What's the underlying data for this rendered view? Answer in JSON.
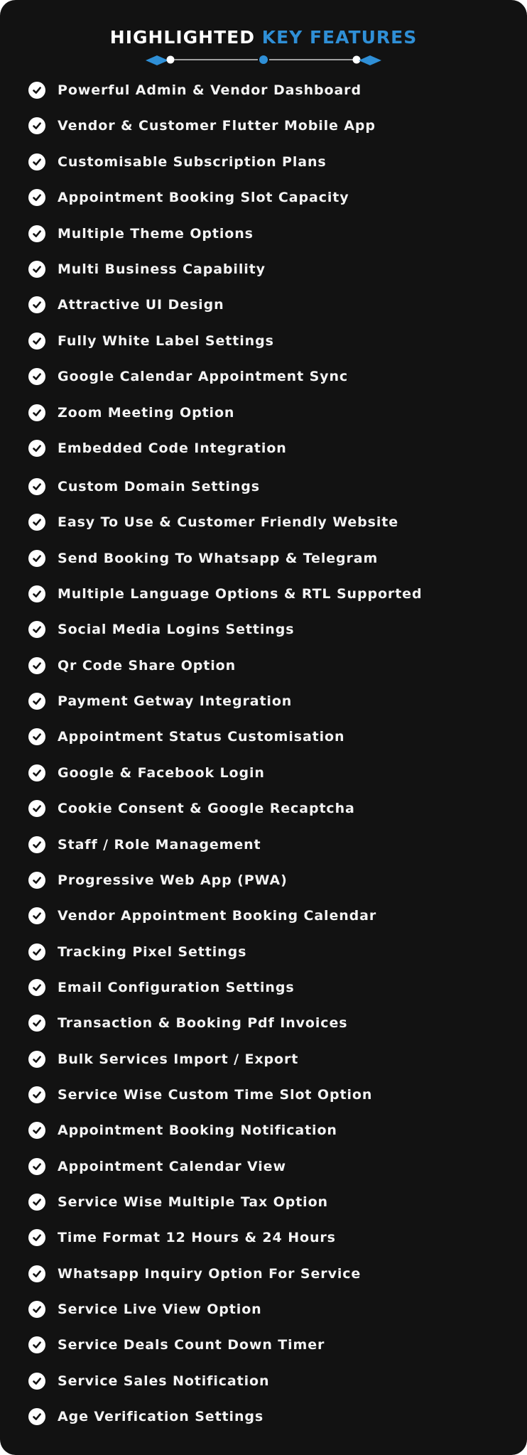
{
  "header": {
    "title_part1": "HIGHLIGHTED",
    "title_part2": "KEY FEATURES",
    "accent_color": "#2f8fd6"
  },
  "features": [
    "Powerful Admin & Vendor Dashboard",
    "Vendor & Customer Flutter Mobile App",
    "Customisable Subscription Plans",
    "Appointment Booking Slot Capacity",
    "Multiple Theme Options",
    "Multi Business Capability",
    "Attractive UI Design",
    "Fully White Label Settings",
    "Google Calendar Appointment Sync",
    "Zoom Meeting Option",
    "Embedded Code Integration",
    "Custom Domain Settings",
    "Easy To Use & Customer Friendly Website",
    "Send Booking To Whatsapp & Telegram",
    "Multiple Language Options & RTL Supported",
    "Social Media Logins Settings",
    "Qr Code Share Option",
    "Payment Getway Integration",
    "Appointment Status Customisation",
    "Google & Facebook Login",
    "Cookie Consent & Google Recaptcha",
    "Staff / Role Management",
    "Progressive Web App (PWA)",
    "Vendor Appointment Booking Calendar",
    "Tracking Pixel Settings",
    "Email Configuration Settings",
    "Transaction & Booking Pdf Invoices",
    "Bulk Services Import / Export",
    "Service Wise Custom Time Slot Option",
    "Appointment Booking Notification",
    "Appointment Calendar View",
    "Service Wise Multiple Tax Option",
    "Time Format 12 Hours & 24 Hours",
    "Whatsapp Inquiry Option For Service",
    "Service Live View Option",
    "Service Deals Count Down Timer",
    "Service Sales Notification",
    "Age Verification Settings"
  ],
  "icons": {
    "feature_bullet": "check-circle-icon"
  }
}
